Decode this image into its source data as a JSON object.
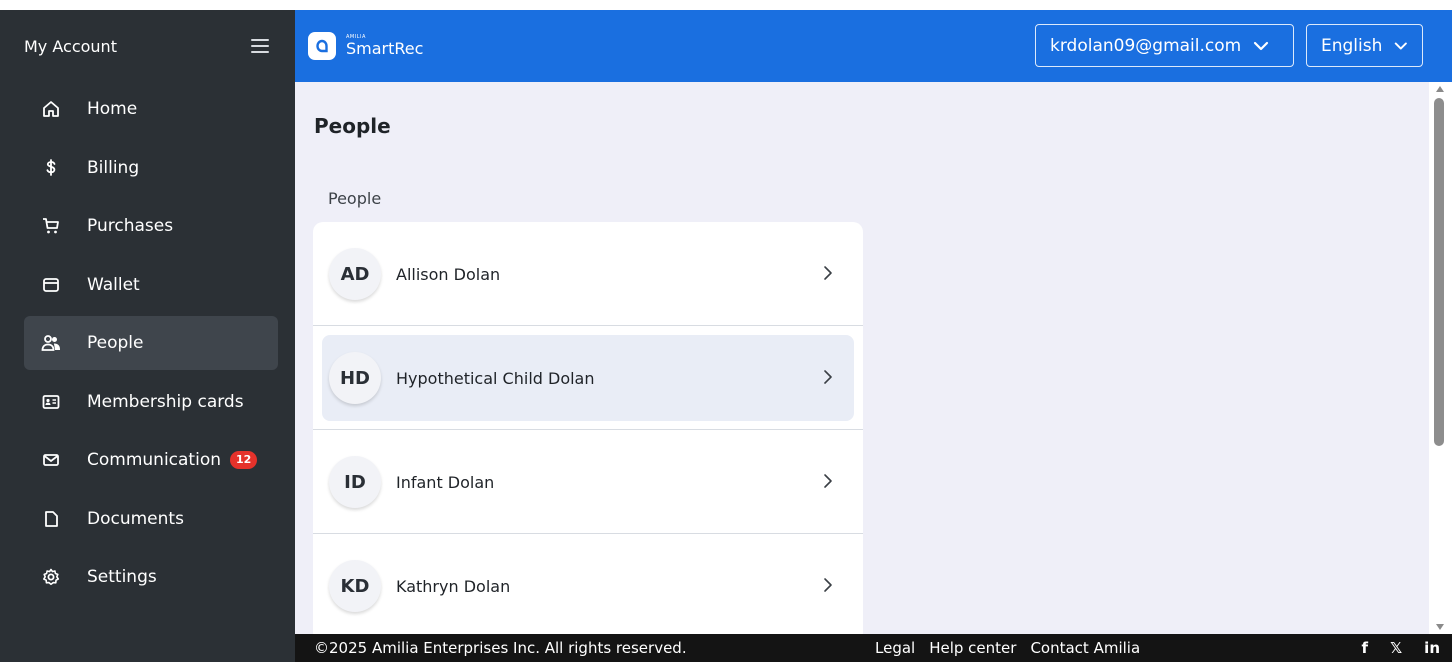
{
  "sidebar": {
    "title": "My Account",
    "items": [
      {
        "label": "Home",
        "icon": "home-icon"
      },
      {
        "label": "Billing",
        "icon": "dollar-icon"
      },
      {
        "label": "Purchases",
        "icon": "cart-icon"
      },
      {
        "label": "Wallet",
        "icon": "wallet-icon"
      },
      {
        "label": "People",
        "icon": "people-icon",
        "active": true
      },
      {
        "label": "Membership cards",
        "icon": "id-card-icon"
      },
      {
        "label": "Communication",
        "icon": "mail-icon",
        "badge": "12"
      },
      {
        "label": "Documents",
        "icon": "document-icon"
      },
      {
        "label": "Settings",
        "icon": "gear-icon"
      }
    ]
  },
  "topbar": {
    "logo_small": "AMILIA",
    "logo_big": "SmartRec",
    "account": "krdolan09@gmail.com",
    "language": "English"
  },
  "main": {
    "title": "People",
    "section_label": "People",
    "people": [
      {
        "initials": "AD",
        "name": "Allison Dolan"
      },
      {
        "initials": "HD",
        "name": "Hypothetical Child Dolan",
        "highlighted": true
      },
      {
        "initials": "ID",
        "name": "Infant Dolan"
      },
      {
        "initials": "KD",
        "name": "Kathryn Dolan"
      }
    ]
  },
  "footer": {
    "copyright": "©2025 Amilia Enterprises Inc. All rights reserved.",
    "links": [
      "Legal",
      "Help center",
      "Contact Amilia"
    ],
    "social": [
      "f",
      "𝕏",
      "in"
    ]
  },
  "colors": {
    "sidebar_bg": "#2b3035",
    "topbar_bg": "#1a6fe0",
    "main_bg": "#efeff8",
    "badge": "#e5322b",
    "footer_bg": "#141414"
  }
}
